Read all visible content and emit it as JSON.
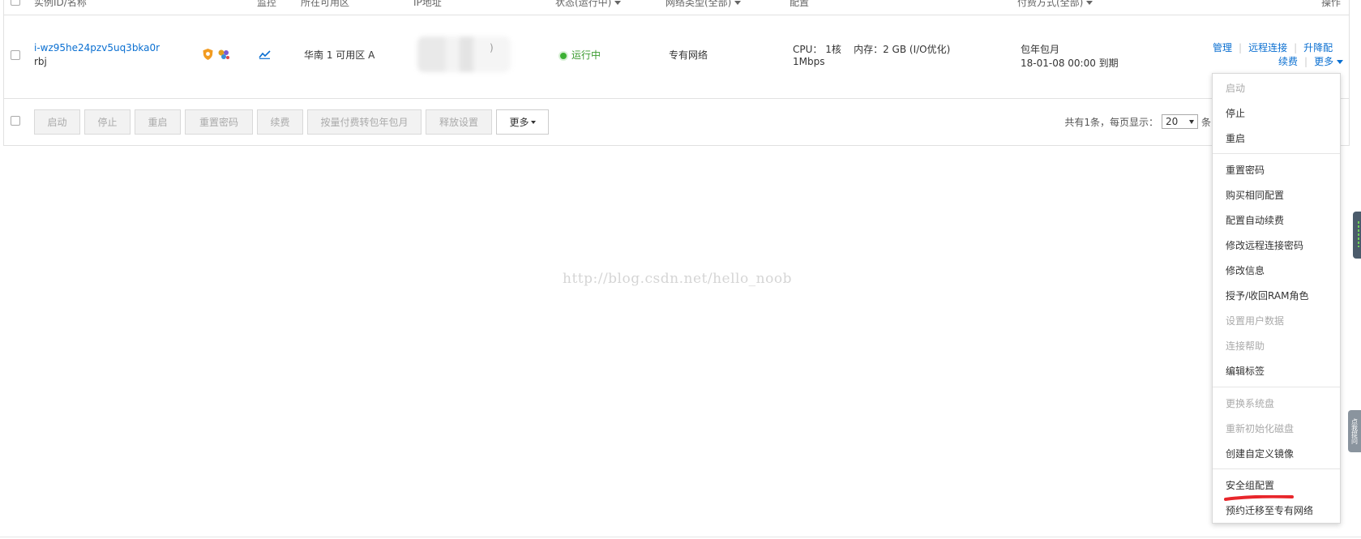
{
  "header": {
    "col_instance": "实例ID/名称",
    "col_monitor": "监控",
    "col_zone": "所在可用区",
    "col_ip": "IP地址",
    "col_status": "状态(运行中)",
    "col_network": "网络类型(全部)",
    "col_config": "配置",
    "col_billing": "付费方式(全部)",
    "col_actions": "操作"
  },
  "row": {
    "instance_id": "i-wz95he24pzv5uq3bka0r",
    "instance_name": "rbj",
    "zone": "华南 1 可用区 A",
    "ip_suffix": ")",
    "status": "运行中",
    "network": "专有网络",
    "config_line1": "CPU： 1核    内存：2 GB (I/O优化)",
    "config_line2": "1Mbps",
    "billing_line1": "包年包月",
    "billing_line2": "18-01-08 00:00 到期",
    "actions": {
      "manage": "管理",
      "remote": "远程连接",
      "upgrade": "升降配",
      "renew": "续费",
      "more": "更多"
    }
  },
  "toolbar": {
    "start": "启动",
    "stop": "停止",
    "restart": "重启",
    "reset_password": "重置密码",
    "renew": "续费",
    "convert_billing": "按量付费转包年包月",
    "release_settings": "释放设置",
    "more": "更多"
  },
  "pager": {
    "total_text": "共有1条，每页显示：",
    "page_size": "20",
    "unit": "条"
  },
  "watermark": "http://blog.csdn.net/hello_noob",
  "dropdown": {
    "items": [
      {
        "label": "启动"
      },
      {
        "label": "停止"
      },
      {
        "label": "重启"
      },
      {
        "label": "重置密码"
      },
      {
        "label": "购买相同配置"
      },
      {
        "label": "配置自动续费"
      },
      {
        "label": "修改远程连接密码"
      },
      {
        "label": "修改信息"
      },
      {
        "label": "授予/收回RAM角色"
      },
      {
        "label": "设置用户数据"
      },
      {
        "label": "连接帮助"
      },
      {
        "label": "编辑标签"
      },
      {
        "label": "更换系统盘"
      },
      {
        "label": "重新初始化磁盘"
      },
      {
        "label": "创建自定义镜像"
      },
      {
        "label": "安全组配置"
      },
      {
        "label": "预约迁移至专有网络"
      }
    ]
  },
  "side_tab": "点我提问",
  "colors": {
    "link": "#0a6fd1",
    "running": "#3cb034",
    "highlight": "#e8262b"
  }
}
